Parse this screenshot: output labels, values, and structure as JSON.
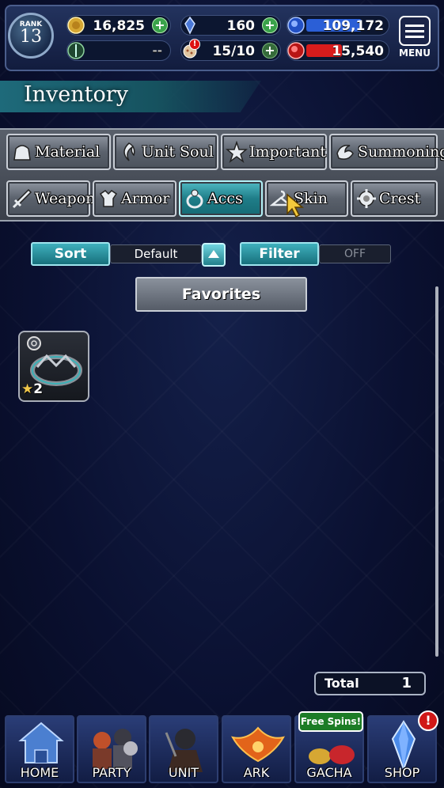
{
  "header": {
    "rank_label": "RANK",
    "rank_value": "13",
    "gil": "16,825",
    "lapis": "160",
    "exp": "109,172",
    "unit_stat": "--",
    "stamina": "15/10",
    "ruby": "15,540",
    "menu_label": "MENU",
    "stamina_alert": "!",
    "exp_fill": 0.7,
    "ruby_fill": 0.45
  },
  "title": "Inventory",
  "tabs": {
    "row1": [
      {
        "label": "Material",
        "icon": "material-icon"
      },
      {
        "label": "Unit Soul",
        "icon": "soul-icon"
      },
      {
        "label": "Important",
        "icon": "star-icon"
      },
      {
        "label": "Summoning",
        "icon": "summon-icon"
      }
    ],
    "row2": [
      {
        "label": "Weapon",
        "icon": "sword-icon"
      },
      {
        "label": "Armor",
        "icon": "armor-icon"
      },
      {
        "label": "Accs",
        "icon": "ring-icon",
        "active": true
      },
      {
        "label": "Skin",
        "icon": "hanger-icon"
      },
      {
        "label": "Crest",
        "icon": "crest-icon"
      }
    ]
  },
  "controls": {
    "sort_label": "Sort",
    "sort_value": "Default",
    "filter_label": "Filter",
    "filter_value": "OFF",
    "favorites_label": "Favorites"
  },
  "items": [
    {
      "name": "ring-accessory",
      "stars": "2",
      "star_glyph": "★"
    }
  ],
  "total": {
    "label": "Total",
    "value": "1"
  },
  "nav": [
    {
      "label": "HOME",
      "icon": "home-icon"
    },
    {
      "label": "PARTY",
      "icon": "party-icon"
    },
    {
      "label": "UNIT",
      "icon": "unit-icon"
    },
    {
      "label": "ARK",
      "icon": "ark-icon"
    },
    {
      "label": "GACHA",
      "icon": "gacha-icon"
    },
    {
      "label": "SHOP",
      "icon": "shop-icon"
    }
  ],
  "gacha_badge": "Free Spins!",
  "shop_alert": "!",
  "colors": {
    "accent_teal": "#1f7d88",
    "gil_plus": "#3aa24a",
    "exp_bar": "#2b5fd6",
    "ruby_bar": "#d81c1c"
  }
}
